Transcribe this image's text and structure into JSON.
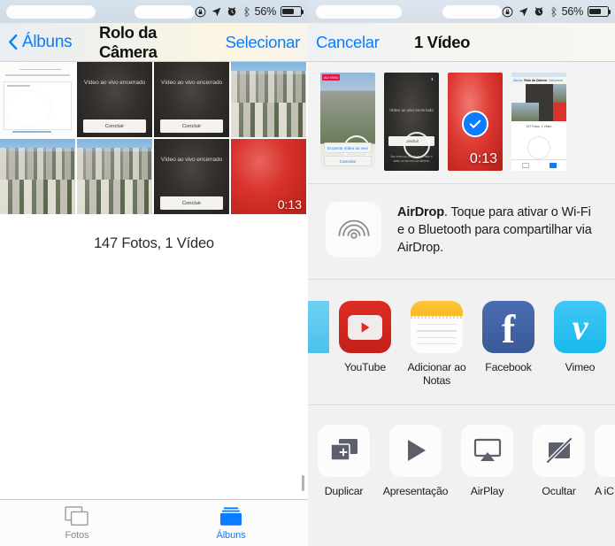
{
  "status_bar": {
    "battery_percent": "56%",
    "icons": [
      "rotation-lock-icon",
      "location-arrow-icon",
      "alarm-clock-icon",
      "bluetooth-icon",
      "battery-icon"
    ]
  },
  "left_panel": {
    "nav": {
      "back_label": "Álbuns",
      "title": "Rolo da Câmera",
      "action_label": "Selecionar"
    },
    "grid": [
      {
        "type": "screenshot-white",
        "label": ""
      },
      {
        "type": "dark-live-video",
        "label": "Vídeo ao vivo encerrado",
        "button": "Concluir"
      },
      {
        "type": "dark-live-video",
        "label": "Vídeo ao vivo encerrado",
        "button": "Concluir"
      },
      {
        "type": "city",
        "label": ""
      },
      {
        "type": "city",
        "label": ""
      },
      {
        "type": "city",
        "label": ""
      },
      {
        "type": "dark-live-video",
        "label": "Vídeo ao vivo encerrado",
        "button": "Concluir"
      },
      {
        "type": "red-video",
        "label": "",
        "duration": "0:13"
      }
    ],
    "count_text": "147 Fotos, 1 Vídeo",
    "tabs": [
      {
        "label": "Fotos",
        "icon": "photos-icon",
        "selected": false
      },
      {
        "label": "Álbuns",
        "icon": "albums-icon",
        "selected": true
      }
    ]
  },
  "right_panel": {
    "nav": {
      "cancel_label": "Cancelar",
      "title": "1 Vídeo"
    },
    "thumbnails": [
      {
        "id": "thumb-screenshot-live",
        "selected": false,
        "duration": "",
        "tag": "AO VIVO",
        "primary_button": "Encerrar vídeo ao vivo",
        "secondary_button": "Cancelar"
      },
      {
        "id": "thumb-dark-live",
        "selected": false,
        "duration": "",
        "label": "Vídeo ao vivo encerrado",
        "button": "Concluir",
        "caption": "Seu vídeo ao vivo foi encerrado e salvo no seu rolo da câmera."
      },
      {
        "id": "thumb-red-video",
        "selected": true,
        "duration": "0:13"
      },
      {
        "id": "thumb-app-screenshot",
        "selected": false,
        "duration": "",
        "mini_back": "Álbuns",
        "mini_title": "Rolo da Câmera",
        "mini_action": "Selecionar",
        "mini_count": "147 Fotos, 1 Vídeo"
      }
    ],
    "airdrop": {
      "icon": "airdrop-icon",
      "bold_prefix": "AirDrop",
      "text": ". Toque para ativar o Wi-Fi e o Bluetooth para compartilhar via AirDrop."
    },
    "apps": [
      {
        "label": "",
        "icon": "app-edge-left-icon",
        "edge": true
      },
      {
        "label": "YouTube",
        "icon": "youtube-icon"
      },
      {
        "label": "Adicionar ao Notas",
        "icon": "notes-icon"
      },
      {
        "label": "Facebook",
        "icon": "facebook-icon"
      },
      {
        "label": "Vimeo",
        "icon": "vimeo-icon"
      },
      {
        "label": "",
        "icon": "app-edge-right-icon",
        "edge": true
      }
    ],
    "actions": [
      {
        "label": "Duplicar",
        "icon": "duplicate-icon"
      },
      {
        "label": "Apresentação",
        "icon": "slideshow-play-icon"
      },
      {
        "label": "AirPlay",
        "icon": "airplay-icon"
      },
      {
        "label": "Ocultar",
        "icon": "hide-icon"
      },
      {
        "label": "A iC",
        "icon": "icloud-drive-icon",
        "edge": true
      }
    ]
  },
  "colors": {
    "accent_blue": "#0a7cff",
    "sheet_bg": "#f2f1f1",
    "tab_inactive": "#8b8b8b"
  }
}
